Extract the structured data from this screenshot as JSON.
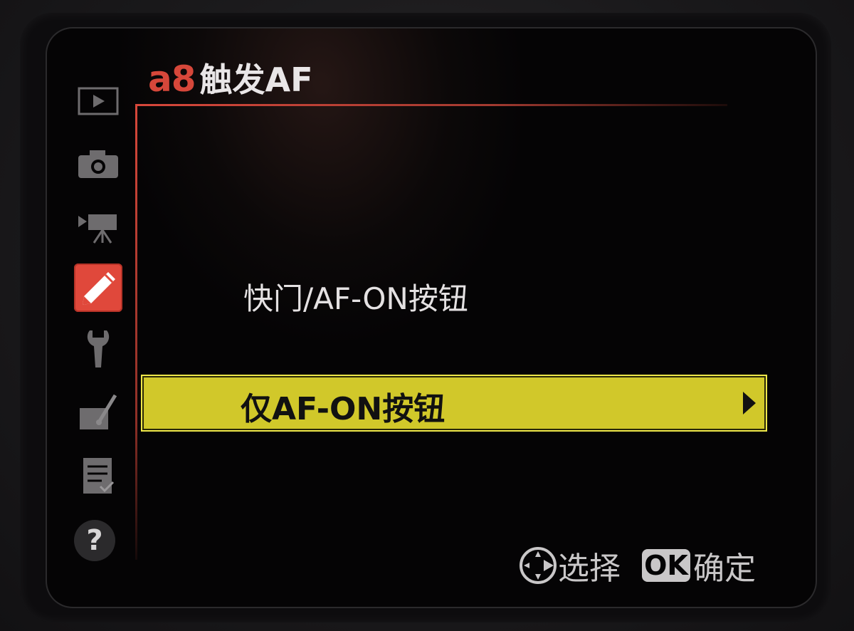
{
  "header": {
    "menu_code": "a8",
    "menu_title": "触发AF"
  },
  "options": [
    {
      "label": "快门/AF-ON按钮",
      "selected": false
    },
    {
      "label": "仅AF-ON按钮",
      "selected": true
    }
  ],
  "footer": {
    "select_label": "选择",
    "ok_chip": "OK",
    "confirm_label": "确定"
  },
  "help": {
    "symbol": "?"
  },
  "sidebar": {
    "items": [
      {
        "icon": "playback-icon",
        "active": false
      },
      {
        "icon": "camera-icon",
        "active": false
      },
      {
        "icon": "movie-camera-icon",
        "active": false
      },
      {
        "icon": "pencil-icon",
        "active": true
      },
      {
        "icon": "wrench-icon",
        "active": false
      },
      {
        "icon": "retouch-brush-icon",
        "active": false
      },
      {
        "icon": "recent-settings-icon",
        "active": false
      }
    ]
  },
  "colors": {
    "accent_red": "#d6473a",
    "highlight_yellow": "#d1c82a",
    "text": "#e4e1e2",
    "screen_bg": "#050405"
  }
}
